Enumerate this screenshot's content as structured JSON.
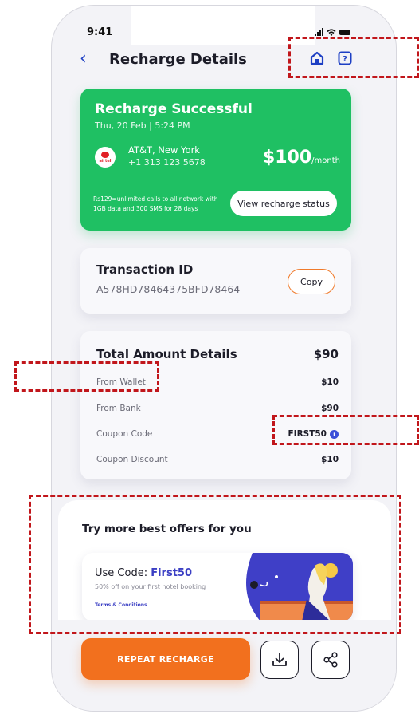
{
  "status_bar": {
    "time": "9:41"
  },
  "header": {
    "title": "Recharge Details"
  },
  "recharge_card": {
    "title": "Recharge Successful",
    "date": "Thu, 20 Feb | 5:24 PM",
    "logo_text": "airtel",
    "operator": "AT&T, New York",
    "number": "+1 313 123 5678",
    "amount": "$100",
    "amount_unit": "/month",
    "plan_description": "Rs129=unlimited calls to all network with 1GB data and 300 SMS for 28 days",
    "status_button": "View recharge status"
  },
  "transaction": {
    "label": "Transaction ID",
    "id": "A578HD78464375BFD78464",
    "copy_label": "Copy"
  },
  "amount_details": {
    "title": "Total Amount Details",
    "total": "$90",
    "rows": [
      {
        "label": "From Wallet",
        "value": "$10"
      },
      {
        "label": "From Bank",
        "value": "$90"
      },
      {
        "label": "Coupon Code",
        "value": "FIRST50"
      },
      {
        "label": "Coupon Discount",
        "value": "$10"
      }
    ]
  },
  "offers": {
    "title": "Try more best offers for you",
    "code_prefix": "Use Code: ",
    "code": "First50",
    "description": "50% off on your first hotel booking",
    "terms": "Terms & Conditions"
  },
  "actions": {
    "repeat_label": "REPEAT RECHARGE"
  },
  "colors": {
    "accent_blue": "#1d3fc4",
    "success_green": "#1fc063",
    "orange": "#f2701e",
    "annotation_red": "#c1161b"
  }
}
